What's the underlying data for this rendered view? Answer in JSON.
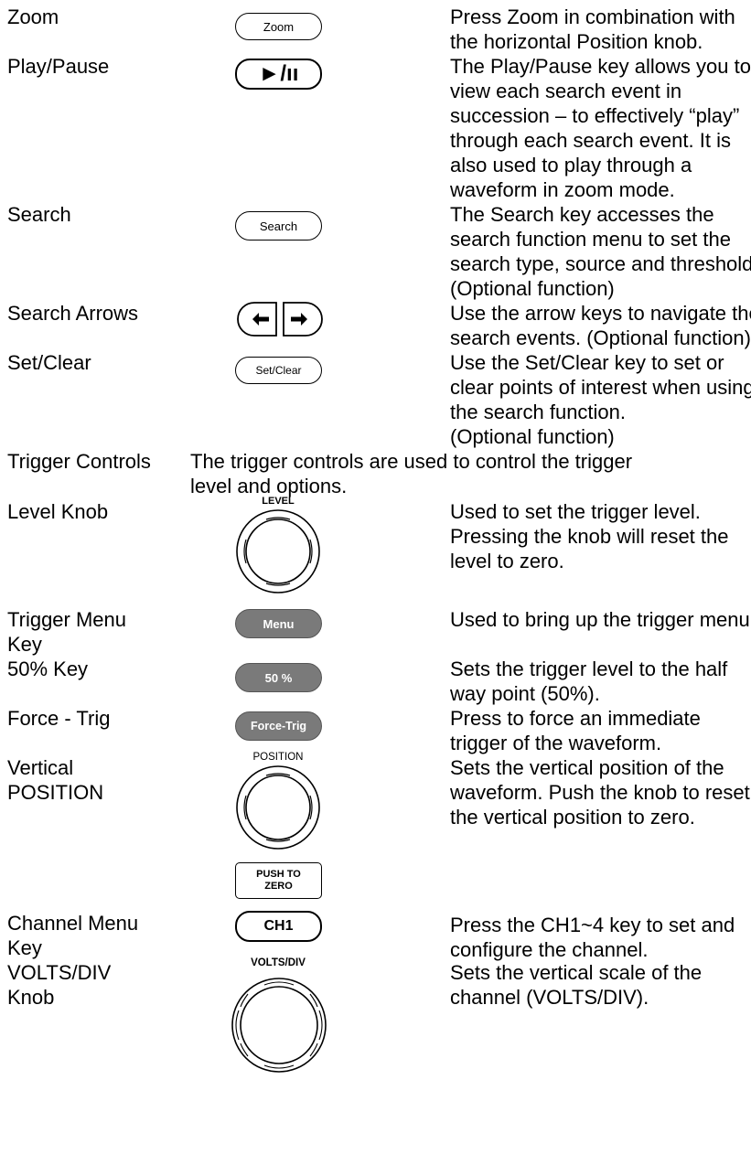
{
  "rows": [
    {
      "name": "Zoom",
      "key_label": "Zoom",
      "desc": [
        "Press Zoom in combination with",
        "the horizontal Position knob."
      ]
    },
    {
      "name": "Play/Pause",
      "key_label": "►/ıı",
      "desc": [
        "The Play/Pause key allows you to",
        "view each search event in",
        "succession – to effectively “play”",
        "through each search event. It is",
        "also used to play through a",
        "waveform in zoom mode."
      ]
    },
    {
      "name": "Search",
      "key_label": "Search",
      "desc": [
        "The Search key accesses the",
        "search function menu to set the",
        "search type, source and threshold.",
        "(Optional function)"
      ]
    },
    {
      "name": "Search Arrows",
      "desc": [
        "Use the arrow keys to navigate the",
        "search events. (Optional function)"
      ]
    },
    {
      "name": "Set/Clear",
      "key_label": "Set/Clear",
      "desc": [
        "Use the Set/Clear key to set or",
        "clear points of interest when using",
        "the search function.",
        "(Optional function)"
      ]
    },
    {
      "name": "Trigger Controls",
      "desc": [
        "The trigger controls are used to control the trigger",
        "level and options."
      ]
    },
    {
      "name": "Level Knob",
      "knob_label": "LEVEL",
      "desc": [
        "Used to set the trigger level.",
        "Pressing the knob will reset the",
        "level to zero."
      ]
    },
    {
      "name": [
        "Trigger Menu",
        "Key"
      ],
      "key_label": "Menu",
      "desc": [
        "Used to bring up the trigger menu."
      ]
    },
    {
      "name": "50% Key",
      "key_label": "50 %",
      "desc": [
        "Sets the trigger level to the half",
        "way point (50%)."
      ]
    },
    {
      "name": "Force - Trig",
      "key_label": "Force-Trig",
      "desc": [
        "Press to force an immediate",
        "trigger of the waveform."
      ]
    },
    {
      "name": [
        "Vertical",
        "POSITION"
      ],
      "knob_label": "POSITION",
      "push_label": [
        "PUSH TO",
        "ZERO"
      ],
      "desc": [
        "Sets the vertical position of the",
        "waveform. Push the knob to reset",
        "the vertical position to zero."
      ]
    },
    {
      "name": [
        "Channel Menu",
        "Key"
      ],
      "key_label": "CH1",
      "desc": [
        "Press the CH1~4 key to set and",
        "configure the channel."
      ]
    },
    {
      "name": [
        "VOLTS/DIV",
        "Knob"
      ],
      "knob_label": "VOLTS/DIV",
      "desc": [
        "Sets the vertical scale of the",
        "channel (VOLTS/DIV)."
      ]
    }
  ]
}
